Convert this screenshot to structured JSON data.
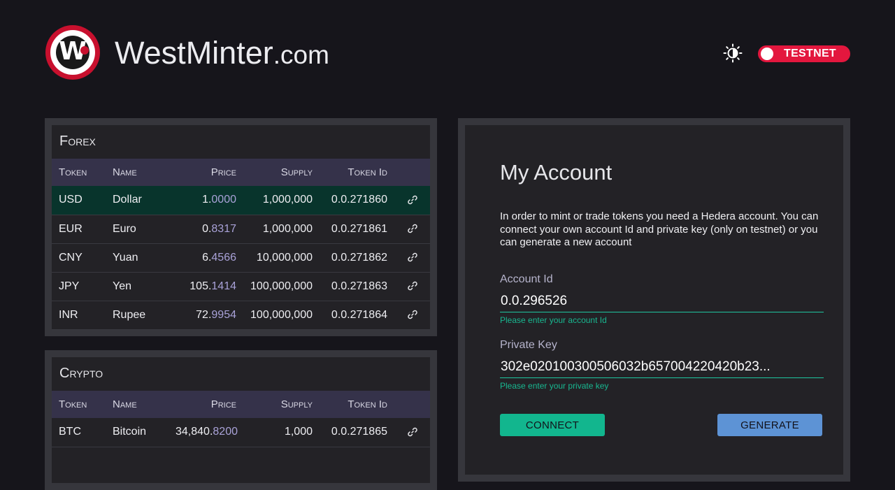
{
  "header": {
    "logo_letter": "W",
    "title_main": "WestMinter",
    "title_domain": ".com",
    "network_label": "TESTNET"
  },
  "colors": {
    "background": "#16151b",
    "accent_red": "#e3173e",
    "accent_green": "#12b68e",
    "accent_blue": "#5d93d5",
    "table_header": "#35324a",
    "selected_row": "#08342c"
  },
  "icons": {
    "theme": "sun-half-icon",
    "row_link": "link-icon"
  },
  "columns": {
    "token": "Token",
    "name": "Name",
    "price": "Price",
    "supply": "Supply",
    "token_id": "Token Id"
  },
  "forex": {
    "title": "Forex",
    "rows": [
      {
        "token": "USD",
        "name": "Dollar",
        "price_int": "1.",
        "price_dec": "0000",
        "supply": "1,000,000",
        "token_id": "0.0.271860"
      },
      {
        "token": "EUR",
        "name": "Euro",
        "price_int": "0.",
        "price_dec": "8317",
        "supply": "1,000,000",
        "token_id": "0.0.271861"
      },
      {
        "token": "CNY",
        "name": "Yuan",
        "price_int": "6.",
        "price_dec": "4566",
        "supply": "10,000,000",
        "token_id": "0.0.271862"
      },
      {
        "token": "JPY",
        "name": "Yen",
        "price_int": "105.",
        "price_dec": "1414",
        "supply": "100,000,000",
        "token_id": "0.0.271863"
      },
      {
        "token": "INR",
        "name": "Rupee",
        "price_int": "72.",
        "price_dec": "9954",
        "supply": "100,000,000",
        "token_id": "0.0.271864"
      }
    ]
  },
  "crypto": {
    "title": "Crypto",
    "rows": [
      {
        "token": "BTC",
        "name": "Bitcoin",
        "price_int": "34,840.",
        "price_dec": "8200",
        "supply": "1,000",
        "token_id": "0.0.271865"
      }
    ]
  },
  "account": {
    "title": "My Account",
    "description": "In order to mint or trade tokens you need a Hedera account. You can connect your own account Id and private key (only on testnet) or you can generate a new account",
    "account_id_label": "Account Id",
    "account_id_value": "0.0.296526",
    "account_id_hint": "Please enter your account Id",
    "private_key_label": "Private Key",
    "private_key_value": "302e020100300506032b657004220420b23...",
    "private_key_hint": "Please enter your private key",
    "connect_label": "CONNECT",
    "generate_label": "GENERATE"
  }
}
